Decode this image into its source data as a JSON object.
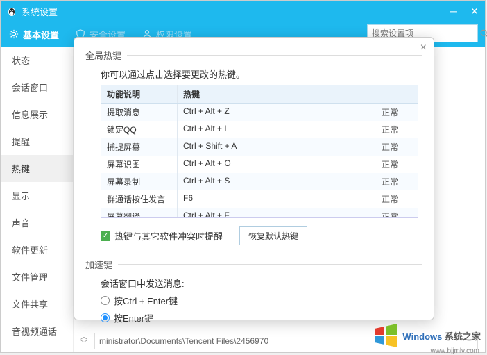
{
  "titlebar": {
    "title": "系统设置"
  },
  "toolbar": {
    "tabs": [
      {
        "label": "基本设置",
        "active": true
      },
      {
        "label": "安全设置"
      },
      {
        "label": "权限设置"
      }
    ],
    "search_placeholder": "搜索设置项"
  },
  "sidebar": {
    "items": [
      {
        "label": "状态"
      },
      {
        "label": "会话窗口"
      },
      {
        "label": "信息展示"
      },
      {
        "label": "提醒"
      },
      {
        "label": "热键",
        "active": true
      },
      {
        "label": "显示"
      },
      {
        "label": "声音"
      },
      {
        "label": "软件更新"
      },
      {
        "label": "文件管理"
      },
      {
        "label": "文件共享"
      },
      {
        "label": "音视频通话"
      }
    ]
  },
  "modal": {
    "section1_title": "全局热键",
    "hint": "你可以通过点击选择要更改的热键。",
    "table": {
      "headers": {
        "fn": "功能说明",
        "hk": "热键",
        "st": ""
      },
      "rows": [
        {
          "fn": "提取消息",
          "hk": "Ctrl + Alt + Z",
          "st": "正常"
        },
        {
          "fn": "锁定QQ",
          "hk": "Ctrl + Alt + L",
          "st": "正常"
        },
        {
          "fn": "捕捉屏幕",
          "hk": "Ctrl + Shift + A",
          "st": "正常"
        },
        {
          "fn": "屏幕识图",
          "hk": "Ctrl + Alt + O",
          "st": "正常"
        },
        {
          "fn": "屏幕录制",
          "hk": "Ctrl + Alt + S",
          "st": "正常"
        },
        {
          "fn": "群通话按住发言",
          "hk": "F6",
          "st": "正常"
        },
        {
          "fn": "屏幕翻译",
          "hk": "Ctrl + Alt + F",
          "st": "正常"
        }
      ]
    },
    "conflict_checkbox_label": "热键与其它软件冲突时提醒",
    "restore_btn": "恢复默认热键",
    "section2_title": "加速键",
    "send_label": "会话窗口中发送消息:",
    "radio_ctrl_enter": "按Ctrl + Enter键",
    "radio_enter": "按Enter键"
  },
  "bottombar": {
    "path": "ministrator\\Documents\\Tencent Files\\2456970"
  },
  "watermark": {
    "t1": "Windows",
    "t2": "系统之家",
    "sub": "www.bjjmlv.com"
  }
}
